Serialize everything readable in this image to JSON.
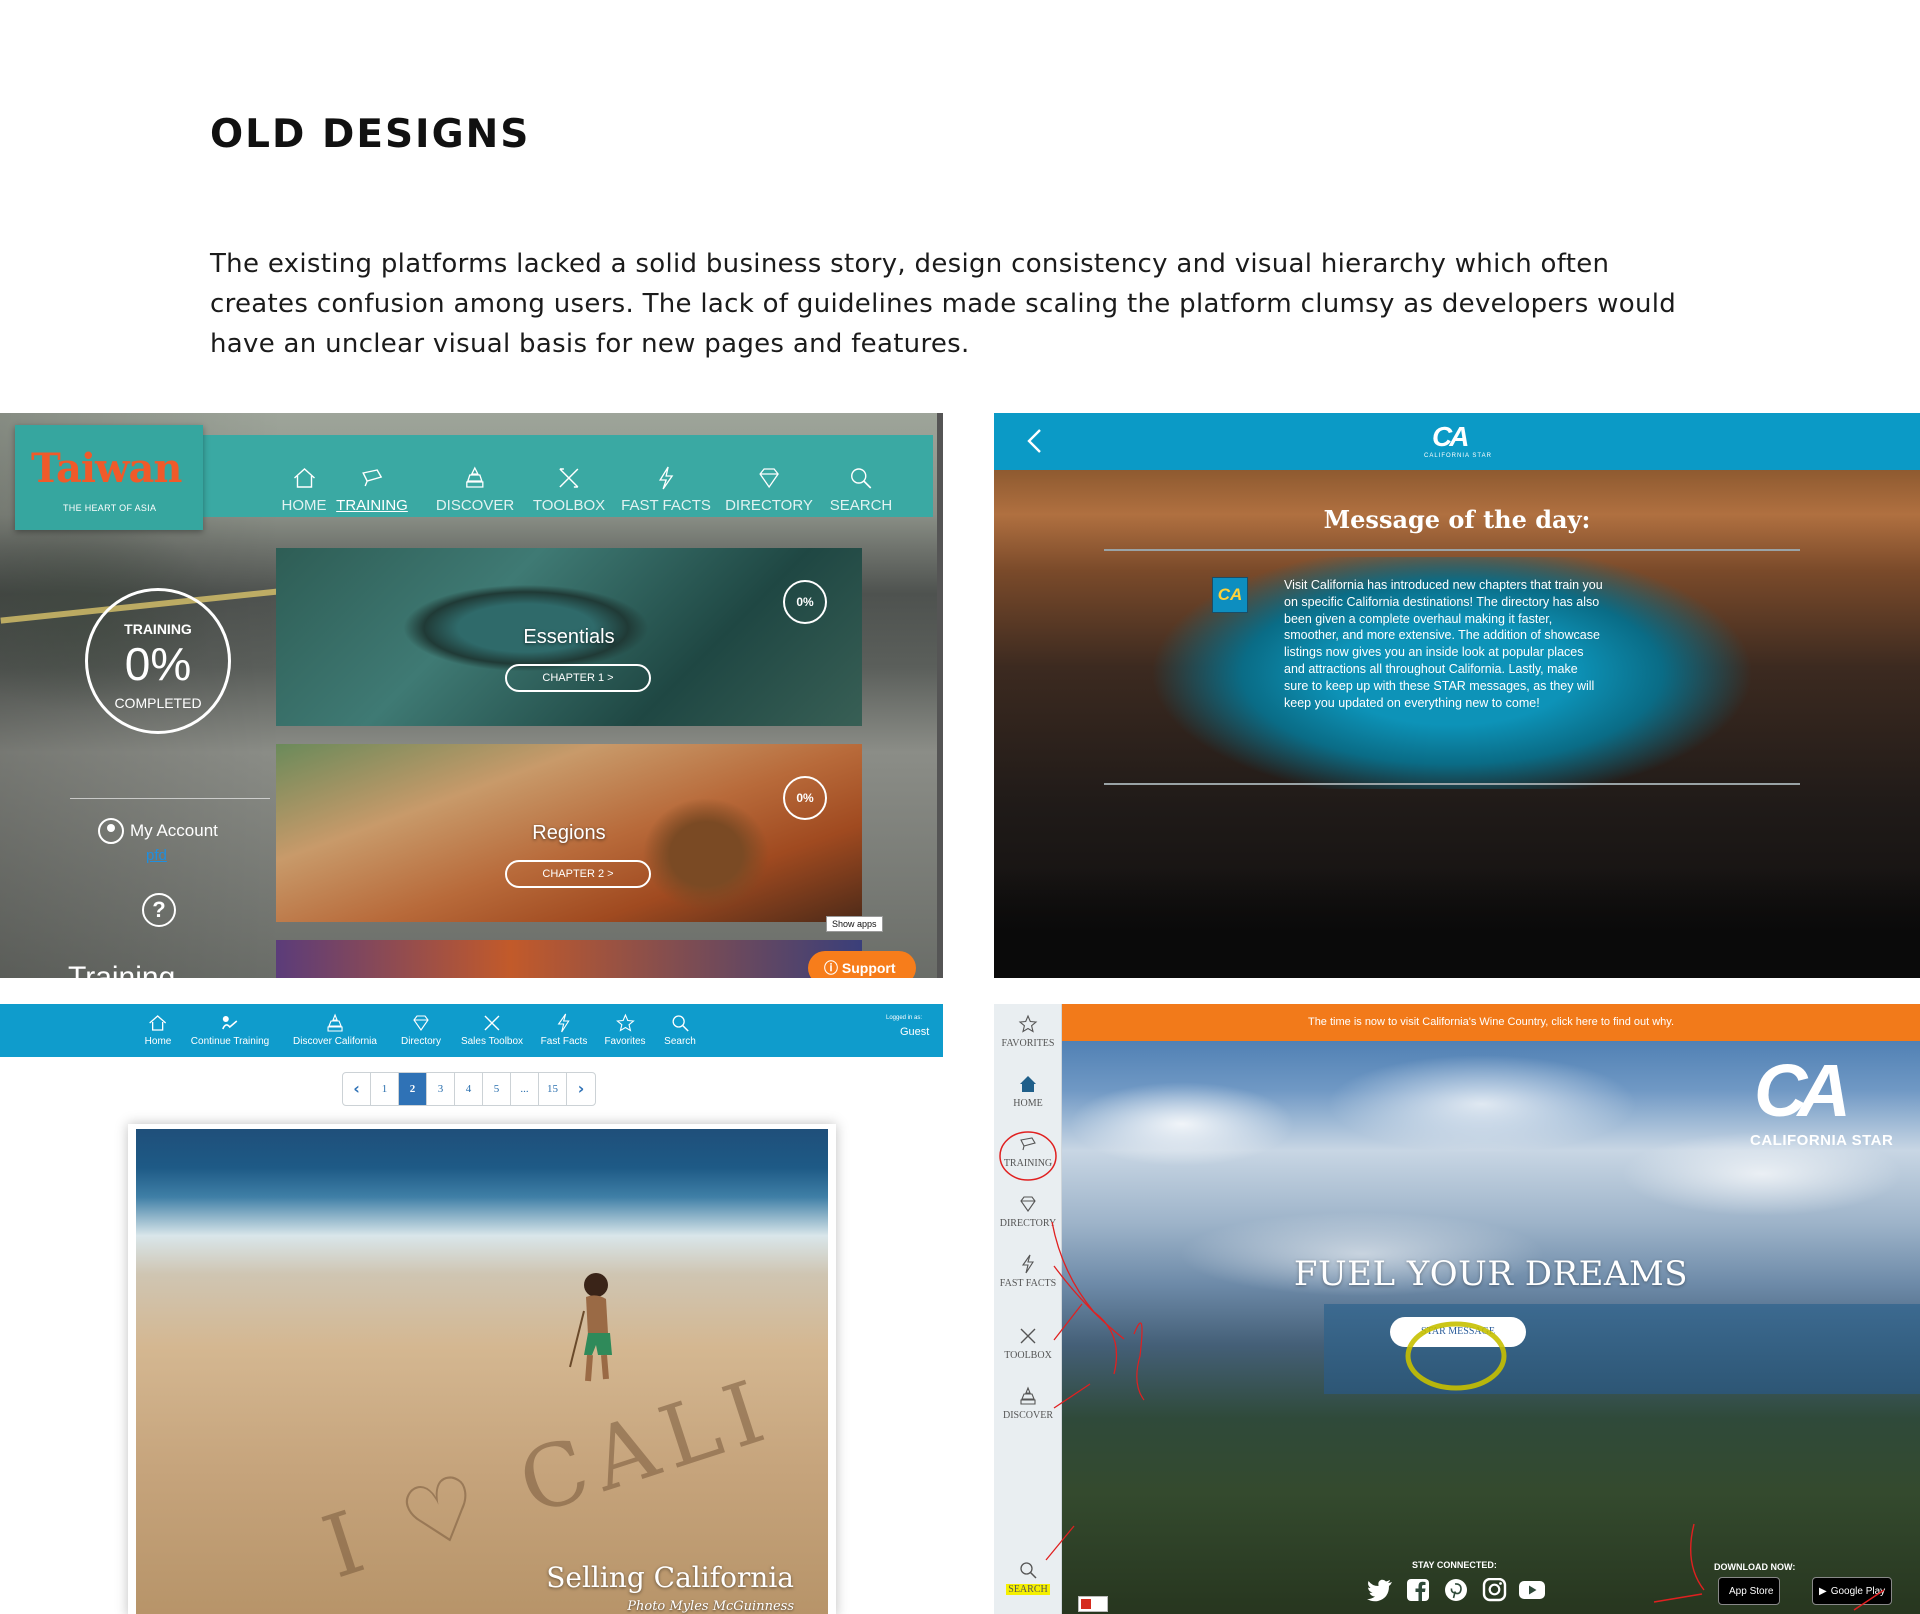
{
  "heading": "OLD DESIGNS",
  "intro": "The existing platforms lacked a solid business story, design consistency and visual hierarchy which often creates confusion among users. The lack of guidelines made scaling the platform clumsy as developers would have an unclear visual basis for new pages and features.",
  "taiwan": {
    "logo": "Taiwan",
    "tagline": "THE HEART OF ASIA",
    "nav": [
      {
        "label": "HOME",
        "icon": "home-icon"
      },
      {
        "label": "TRAINING",
        "icon": "training-icon"
      },
      {
        "label": "DISCOVER",
        "icon": "discover-icon"
      },
      {
        "label": "TOOLBOX",
        "icon": "toolbox-icon"
      },
      {
        "label": "FAST FACTS",
        "icon": "lightning-icon"
      },
      {
        "label": "DIRECTORY",
        "icon": "diamond-icon"
      },
      {
        "label": "SEARCH",
        "icon": "search-icon"
      }
    ],
    "active_nav": "TRAINING",
    "progress": {
      "top": "TRAINING",
      "value": "0%",
      "bottom": "COMPLETED"
    },
    "account_label": "My Account",
    "account_link": "pfd",
    "cut_text": "Training",
    "cards": [
      {
        "title": "Essentials",
        "chapter": "CHAPTER 1 >",
        "percent": "0%"
      },
      {
        "title": "Regions",
        "chapter": "CHAPTER 2 >",
        "percent": "0%"
      }
    ],
    "show_apps": "Show apps",
    "support": "Support"
  },
  "motd": {
    "logo": "CA",
    "logo_sub": "CALIFORNIA STAR",
    "title": "Message of the day:",
    "icon": "CA",
    "message": "Visit California has introduced new chapters that train you on specific California destinations! The directory has also been given a complete overhaul making it faster, smoother, and more extensive. The addition of showcase listings now gives you an inside look at popular places and attractions all throughout California. Lastly, make sure to keep up with these STAR messages, as they will keep you updated on everything new to come!"
  },
  "selling": {
    "nav": [
      {
        "label": "Home",
        "icon": "home-icon"
      },
      {
        "label": "Continue Training",
        "icon": "training-icon"
      },
      {
        "label": "Discover California",
        "icon": "discover-icon"
      },
      {
        "label": "Directory",
        "icon": "diamond-icon"
      },
      {
        "label": "Sales Toolbox",
        "icon": "toolbox-icon"
      },
      {
        "label": "Fast Facts",
        "icon": "lightning-icon"
      },
      {
        "label": "Favorites",
        "icon": "star-icon"
      },
      {
        "label": "Search",
        "icon": "search-icon"
      }
    ],
    "logged_in": "Logged in as:",
    "user": "Guest",
    "pages": [
      "1",
      "2",
      "3",
      "4",
      "5",
      "...",
      "15"
    ],
    "current_page": "2",
    "sand_text": "I ♡ CALI",
    "photo_title": "Selling California",
    "photo_credit": "Photo Myles McGuinness"
  },
  "star": {
    "sidebar": [
      {
        "label": "FAVORITES",
        "icon": "star-icon"
      },
      {
        "label": "HOME",
        "icon": "home-icon"
      },
      {
        "label": "TRAINING",
        "icon": "training-icon"
      },
      {
        "label": "DIRECTORY",
        "icon": "diamond-icon"
      },
      {
        "label": "FAST FACTS",
        "icon": "lightning-icon"
      },
      {
        "label": "TOOLBOX",
        "icon": "toolbox-icon"
      },
      {
        "label": "DISCOVER",
        "icon": "discover-icon"
      },
      {
        "label": "SEARCH",
        "icon": "search-icon"
      }
    ],
    "promo": "The time is now to visit California's Wine Country, click here to find out why.",
    "logo": "CA",
    "logo_sub": "CALIFORNIA STAR",
    "hero": "FUEL YOUR DREAMS",
    "button": "STAR MESSAGE",
    "stay_connected": "STAY CONNECTED:",
    "download_now": "DOWNLOAD NOW:",
    "app_store": "App Store",
    "google_play": "Google Play",
    "socials": [
      "twitter-icon",
      "facebook-icon",
      "pinterest-icon",
      "instagram-icon",
      "youtube-icon"
    ],
    "colors": {
      "promo": "#f27a1a",
      "highlight": "#f5f000",
      "annotation": "#e02020"
    }
  }
}
